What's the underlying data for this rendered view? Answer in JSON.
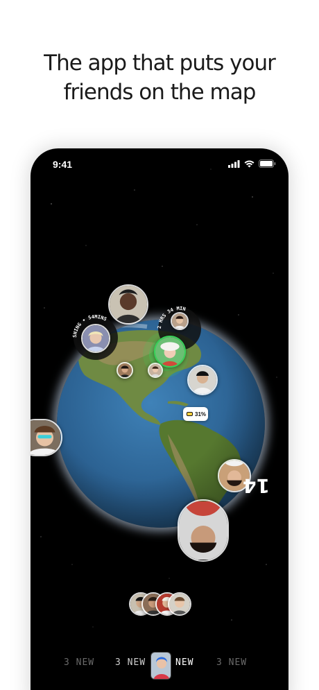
{
  "headline": {
    "line1": "The app that puts your",
    "line2": "friends on the map"
  },
  "status_bar": {
    "time": "9:41",
    "icons": [
      "cellular-signal-icon",
      "wifi-icon",
      "battery-icon"
    ]
  },
  "map": {
    "ring_labels": [
      "SHING • 54MINS",
      "2 HRS 34 MIN"
    ],
    "battery_badge": "31%",
    "friend_count_badge": "14"
  },
  "tabs": [
    {
      "label": "3 NEW",
      "state": "dim"
    },
    {
      "label": "3 NEW",
      "state": "mid"
    },
    {
      "label": "NEW",
      "state": "active"
    },
    {
      "label": "3 NEW",
      "state": "dim"
    }
  ],
  "colors": {
    "background": "#ffffff",
    "phone": "#000000",
    "ocean": "#2f6a9c",
    "land": "#6e8a3e",
    "highlight_ring": "#38d15a"
  }
}
